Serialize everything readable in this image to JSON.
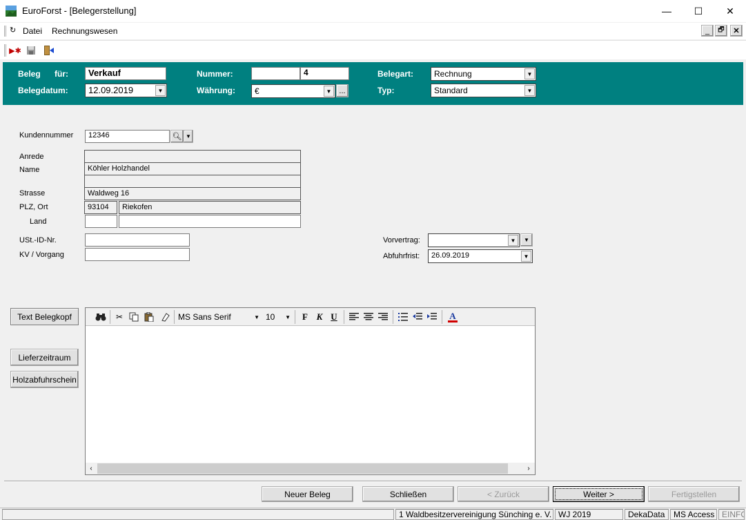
{
  "window": {
    "title": "EuroForst - [Belegerstellung]",
    "minimize": "—",
    "maximize": "☐",
    "close": "✕"
  },
  "menu": {
    "items": [
      {
        "label": "Datei"
      },
      {
        "label": "Rechnungswesen"
      }
    ],
    "mdi_min": "_",
    "mdi_restore": "🗗",
    "mdi_close": "✕"
  },
  "toolbar": {
    "icons": [
      "new-icon",
      "save-icon",
      "exit-icon"
    ]
  },
  "header": {
    "beleg_label": "Beleg",
    "fuer_label": "für:",
    "beleg_value": "Verkauf",
    "belegdatum_label": "Belegdatum:",
    "belegdatum_value": "12.09.2019",
    "nummer_label": "Nummer:",
    "nummer_value": "4",
    "waehrung_label": "Währung:",
    "waehrung_value": "€",
    "waehrung_more": "...",
    "belegart_label": "Belegart:",
    "belegart_value": "Rechnung",
    "typ_label": "Typ:",
    "typ_value": "Standard",
    "accent_color": "#008080"
  },
  "customer": {
    "kundennummer_label": "Kundennummer",
    "kundennummer_value": "12346",
    "anrede_label": "Anrede",
    "anrede_value": "",
    "name_label": "Name",
    "name_value": "Köhler Holzhandel",
    "name2_value": "",
    "strasse_label": "Strasse",
    "strasse_value": "Waldweg 16",
    "plz_ort_label": "PLZ, Ort",
    "plz_value": "93104",
    "ort_value": "Riekofen",
    "land_label": "Land",
    "land_code_value": "",
    "land_value": "",
    "ust_label": "USt.-ID-Nr.",
    "ust_value": "",
    "kv_label": "KV / Vorgang",
    "kv_value": ""
  },
  "right": {
    "vorvertrag_label": "Vorvertrag:",
    "vorvertrag_value": "",
    "abfuhrfrist_label": "Abfuhrfrist:",
    "abfuhrfrist_value": "26.09.2019"
  },
  "side_buttons": {
    "text_belegkopf": "Text Belegkopf",
    "lieferzeitraum": "Lieferzeitraum",
    "holzabfuhrschein": "Holzabfuhrschein"
  },
  "editor": {
    "font": "MS Sans Serif",
    "size": "10",
    "bold": "F",
    "italic": "K",
    "underline": "U",
    "content": ""
  },
  "bottom_buttons": {
    "neuer_beleg": "Neuer Beleg",
    "schliessen": "Schließen",
    "zurueck": "< Zurück",
    "weiter": "Weiter >",
    "fertigstellen": "Fertigstellen"
  },
  "status": {
    "org": "1 Waldbesitzervereinigung Sünching e. V.",
    "wj": "WJ 2019",
    "db": "DekaData",
    "access": "MS Access",
    "mode": "EINFG"
  }
}
